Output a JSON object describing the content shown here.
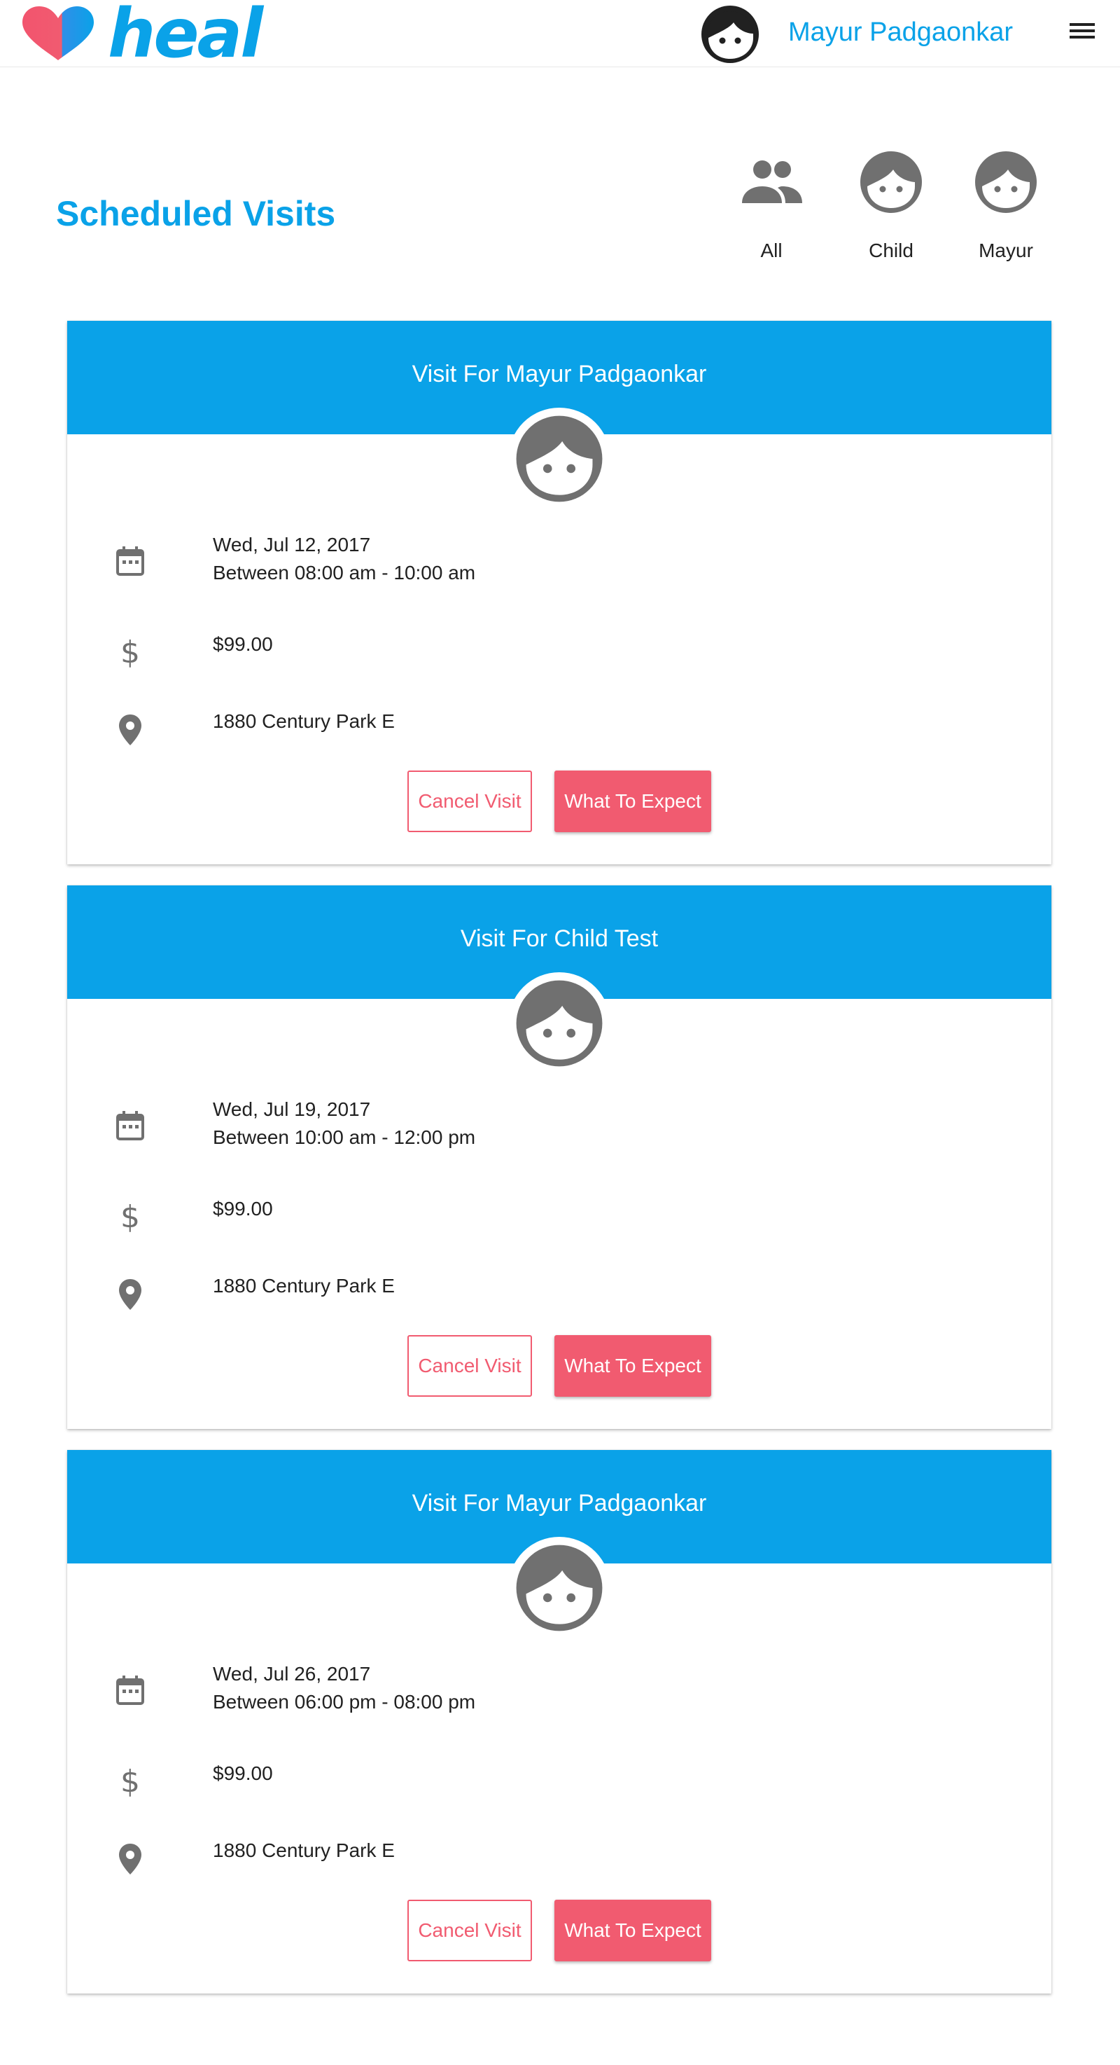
{
  "app": {
    "logo_text": "heal",
    "user_name": "Mayur Padgaonkar",
    "brand_color": "#0aa2e8",
    "accent_color": "#f15b70"
  },
  "page": {
    "title": "Scheduled Visits"
  },
  "filters": [
    {
      "label": "All",
      "icon": "people-icon"
    },
    {
      "label": "Child",
      "icon": "face-icon"
    },
    {
      "label": "Mayur",
      "icon": "face-icon"
    }
  ],
  "visits": [
    {
      "title": "Visit For Mayur Padgaonkar",
      "date": "Wed, Jul 12, 2017",
      "time": "Between 08:00 am - 10:00 am",
      "price": "$99.00",
      "address": "1880 Century Park E",
      "cancel_label": "Cancel Visit",
      "expect_label": "What To Expect"
    },
    {
      "title": "Visit For Child Test",
      "date": "Wed, Jul 19, 2017",
      "time": "Between 10:00 am - 12:00 pm",
      "price": "$99.00",
      "address": "1880 Century Park E",
      "cancel_label": "Cancel Visit",
      "expect_label": "What To Expect"
    },
    {
      "title": "Visit For Mayur Padgaonkar",
      "date": "Wed, Jul 26, 2017",
      "time": "Between 06:00 pm - 08:00 pm",
      "price": "$99.00",
      "address": "1880 Century Park E",
      "cancel_label": "Cancel Visit",
      "expect_label": "What To Expect"
    }
  ]
}
